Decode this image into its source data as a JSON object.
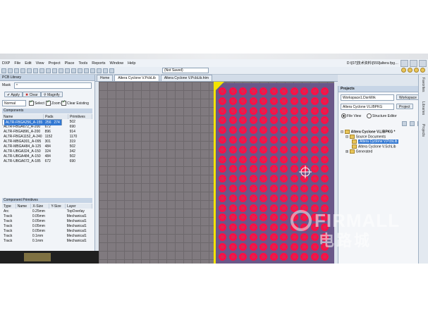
{
  "menu": {
    "items": [
      "DXP",
      "File",
      "Edit",
      "View",
      "Project",
      "Place",
      "Tools",
      "Reports",
      "Window",
      "Help"
    ],
    "path": "D:\\[07]技术资料\\[559]altera fpg…"
  },
  "toolbar": {
    "doc_status": "(Not Saved)"
  },
  "pcb_library": {
    "title": "PCB Library",
    "mask_label": "Mask",
    "mask_value": "*",
    "apply": "Apply",
    "clear": "Clear",
    "magnify": "Magnify",
    "mode": "Normal",
    "select": "Select",
    "zoom": "Zoom",
    "clear_existing": "Clear Existing",
    "components_header": "Components",
    "columns": [
      "Name",
      "Pads",
      "Primitives"
    ],
    "rows": [
      [
        "ALTR-FBGA256_A-155",
        "256",
        "274"
      ],
      [
        "ALTR-FBGA484_A-200",
        "484",
        "502"
      ],
      [
        "ALTR-FBGA672_A-200",
        "672",
        "690"
      ],
      [
        "ALTR-FBGA896_A-200",
        "896",
        "914"
      ],
      [
        "ALTR-FBGA1152_A-240",
        "1152",
        "1170"
      ],
      [
        "ALTR-MBGA301_A-095",
        "301",
        "319"
      ],
      [
        "ALTR-MBGA484_A-125",
        "484",
        "502"
      ],
      [
        "ALTR-UBGA324_A-150",
        "324",
        "342"
      ],
      [
        "ALTR-UBGA484_A-150",
        "484",
        "502"
      ],
      [
        "ALTR-UBGA672_A-185",
        "672",
        "690"
      ]
    ],
    "selected_row": 0,
    "primitives_header": "Component Primitives",
    "prim_columns": [
      "Type",
      "Name",
      "X-Size",
      "Y-Size",
      "Layer"
    ],
    "prim_rows": [
      [
        "Arc",
        "",
        "0.25mm",
        "",
        "TopOverlay"
      ],
      [
        "Track",
        "",
        "0.05mm",
        "",
        "Mechanical1"
      ],
      [
        "Track",
        "",
        "0.05mm",
        "",
        "Mechanical1"
      ],
      [
        "Track",
        "",
        "0.05mm",
        "",
        "Mechanical1"
      ],
      [
        "Track",
        "",
        "0.05mm",
        "",
        "Mechanical1"
      ],
      [
        "Track",
        "",
        "0.1mm",
        "",
        "Mechanical1"
      ],
      [
        "Track",
        "",
        "0.1mm",
        "",
        "Mechanical1"
      ]
    ]
  },
  "doc_tabs": [
    "Home",
    "Altera Cyclone V.PcbLib",
    "Altera Cyclone V.PcbLib.htm"
  ],
  "projects": {
    "title": "Projects",
    "workspace_value": "Workspace1.DsnWrk",
    "workspace_btn": "Workspace",
    "project_value": "Altera Cyclone V.LIBPKG",
    "project_btn": "Project",
    "file_view": "File View",
    "structure_editor": "Structure Editor",
    "tree": {
      "root": "Altera Cyclone V.LIBPKG *",
      "source": "Source Documents",
      "pcblib": "Altera Cyclone V.PcbLib",
      "schlib": "Altera Cyclone V.SchLib",
      "generated": "Generated"
    }
  },
  "side_tabs": [
    "Favorites",
    "Libraries",
    "Projects"
  ],
  "watermark": {
    "brand": "FIRMALL",
    "cn": "电路城"
  },
  "colors": {
    "pad": "#ff0e45",
    "board": "#6a5889",
    "selection": "#3378d2",
    "keepout": "#f3e400"
  }
}
